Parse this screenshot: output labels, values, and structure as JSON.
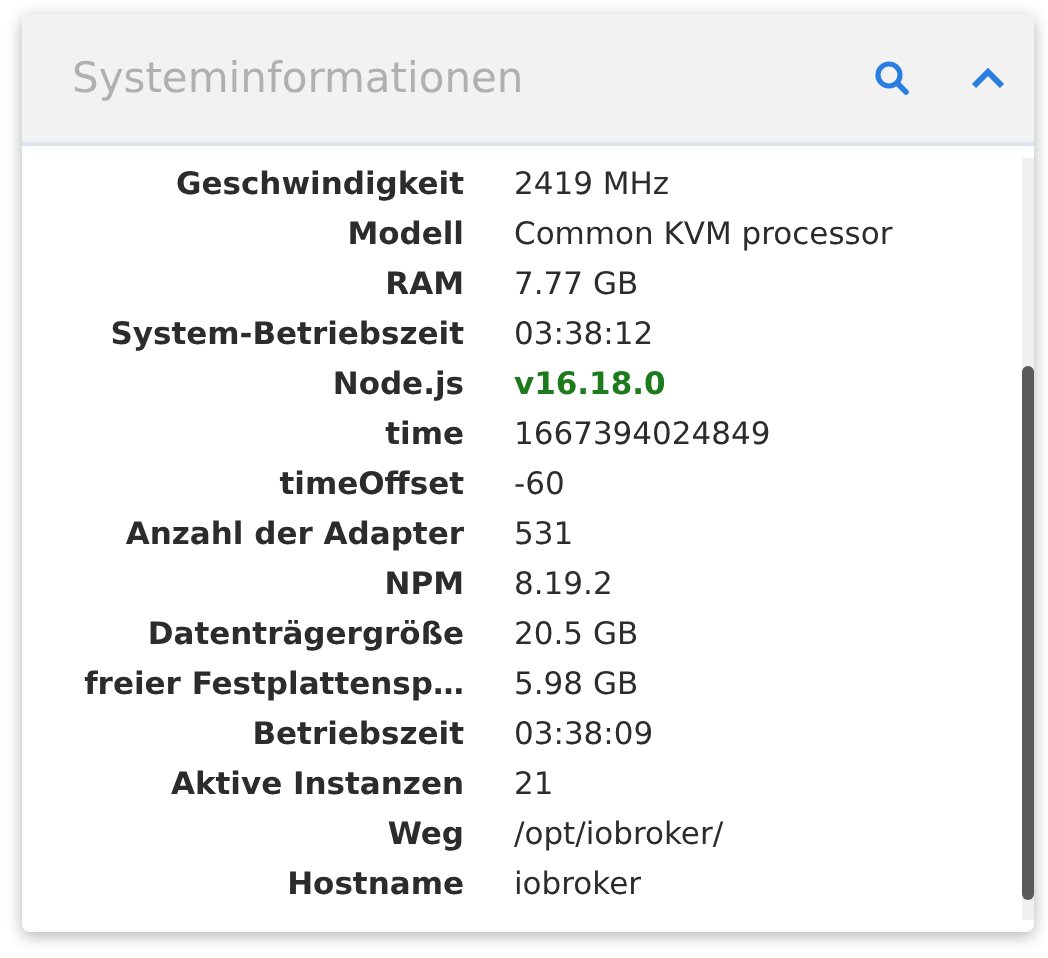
{
  "panel": {
    "title": "Systeminformationen"
  },
  "rows": [
    {
      "label": "Geschwindigkeit",
      "value": "2419 MHz",
      "kind": "plain"
    },
    {
      "label": "Modell",
      "value": "Common KVM processor",
      "kind": "plain"
    },
    {
      "label": "RAM",
      "value": "7.77 GB",
      "kind": "plain"
    },
    {
      "label": "System-Betriebszeit",
      "value": "03:38:12",
      "kind": "plain"
    },
    {
      "label": "Node.js",
      "value": "v16.18.0",
      "kind": "version"
    },
    {
      "label": "time",
      "value": "1667394024849",
      "kind": "plain"
    },
    {
      "label": "timeOffset",
      "value": "-60",
      "kind": "plain"
    },
    {
      "label": "Anzahl der Adapter",
      "value": "531",
      "kind": "plain"
    },
    {
      "label": "NPM",
      "value": "8.19.2",
      "kind": "plain"
    },
    {
      "label": "Datenträgergröße",
      "value": "20.5 GB",
      "kind": "plain"
    },
    {
      "label": "freier Festplattensp…",
      "value": "5.98 GB",
      "kind": "plain"
    },
    {
      "label": "Betriebszeit",
      "value": "03:38:09",
      "kind": "plain"
    },
    {
      "label": "Aktive Instanzen",
      "value": "21",
      "kind": "plain"
    },
    {
      "label": "Weg",
      "value": "/opt/iobroker/",
      "kind": "plain"
    },
    {
      "label": "Hostname",
      "value": "iobroker",
      "kind": "plain"
    }
  ]
}
